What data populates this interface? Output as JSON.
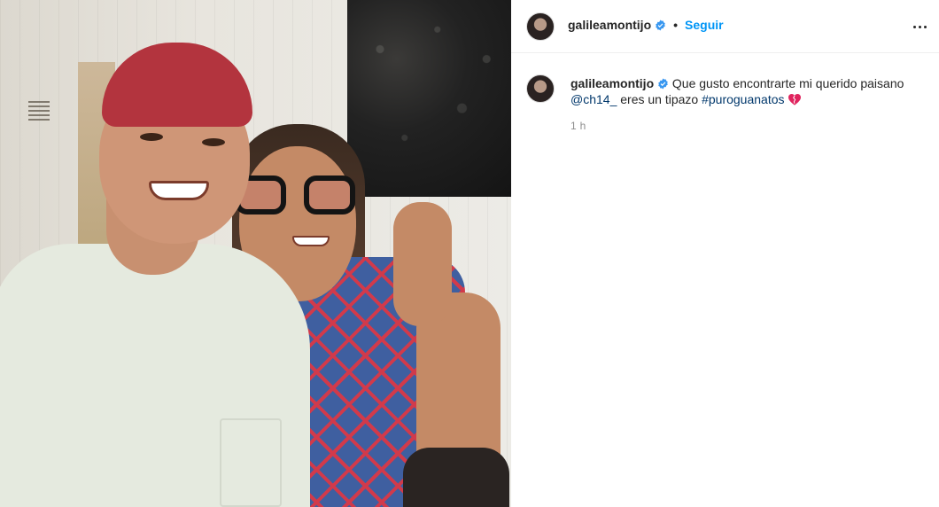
{
  "post": {
    "author": {
      "username": "galileamontijo",
      "verified": true
    },
    "header": {
      "separator": "•",
      "follow_label": "Seguir",
      "more_icon": "more-options-icon"
    },
    "caption": {
      "username": "galileamontijo",
      "text_before_mention": "Que gusto encontrarte mi querido paisano",
      "mention": "@ch14_",
      "text_between": "eres un tipazo",
      "hashtag": "#puroguanatos",
      "emoji_icon": "broken-heart-icon",
      "timestamp": "1 h"
    },
    "photo": {
      "description_icon": "post-photo"
    }
  },
  "colors": {
    "accent": "#0095f6",
    "link": "#00376b",
    "verified_badge": "#3897f0",
    "muted_text": "#8e8e8e",
    "heart": "#e0245e"
  }
}
